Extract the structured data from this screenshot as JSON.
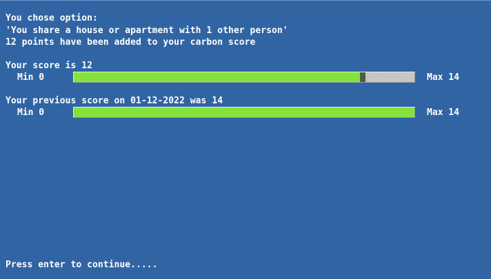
{
  "message": {
    "line1": "You chose option:",
    "line2": "'You share a house or apartment with 1 other person'",
    "line3": "12 points have been added to your carbon score"
  },
  "current_score": {
    "title": "Your score is 12",
    "min_label": "Min 0",
    "max_label": "Max 14",
    "value": 12,
    "min": 0,
    "max": 14,
    "fill_color": "#84e33a",
    "marker_color": "#4f5d46",
    "track_color": "#cfcfcf"
  },
  "previous_score": {
    "title": "Your previous score on 01-12-2022 was 14",
    "min_label": "Min 0",
    "max_label": "Max 14",
    "value": 14,
    "min": 0,
    "max": 14,
    "fill_color": "#84e33a",
    "track_color": "#cfcfcf"
  },
  "footer": {
    "prompt": "Press enter to continue....."
  },
  "colors": {
    "background": "#3164a3",
    "text": "#ffffff"
  }
}
